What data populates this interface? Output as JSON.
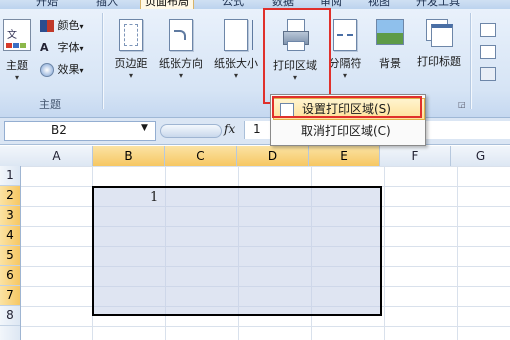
{
  "tabs": [
    "开始",
    "插入",
    "页面布局",
    "公式",
    "数据",
    "审阅",
    "视图",
    "开发工具"
  ],
  "themes_group": {
    "label": "主题",
    "theme_button": "主题",
    "colors": "颜色",
    "fonts": "字体",
    "effects": "效果"
  },
  "page_setup": {
    "margins": "页边距",
    "orientation": "纸张方向",
    "size": "纸张大小",
    "print_area": "打印区域",
    "breaks": "分隔符",
    "background": "背景",
    "print_titles": "打印标题"
  },
  "print_area_menu": {
    "set": "设置打印区域(S)",
    "clear": "取消打印区域(C)"
  },
  "formula_bar": {
    "name_box": "B2",
    "fx": "fx",
    "content": "1"
  },
  "columns": [
    "A",
    "B",
    "C",
    "D",
    "E",
    "F",
    "G"
  ],
  "rows": [
    "1",
    "2",
    "3",
    "4",
    "5",
    "6",
    "7",
    "8"
  ],
  "cells": {
    "B2": "1"
  },
  "colors": {
    "highlight_border": "#e0302b",
    "selected_header": "#f6c763"
  }
}
